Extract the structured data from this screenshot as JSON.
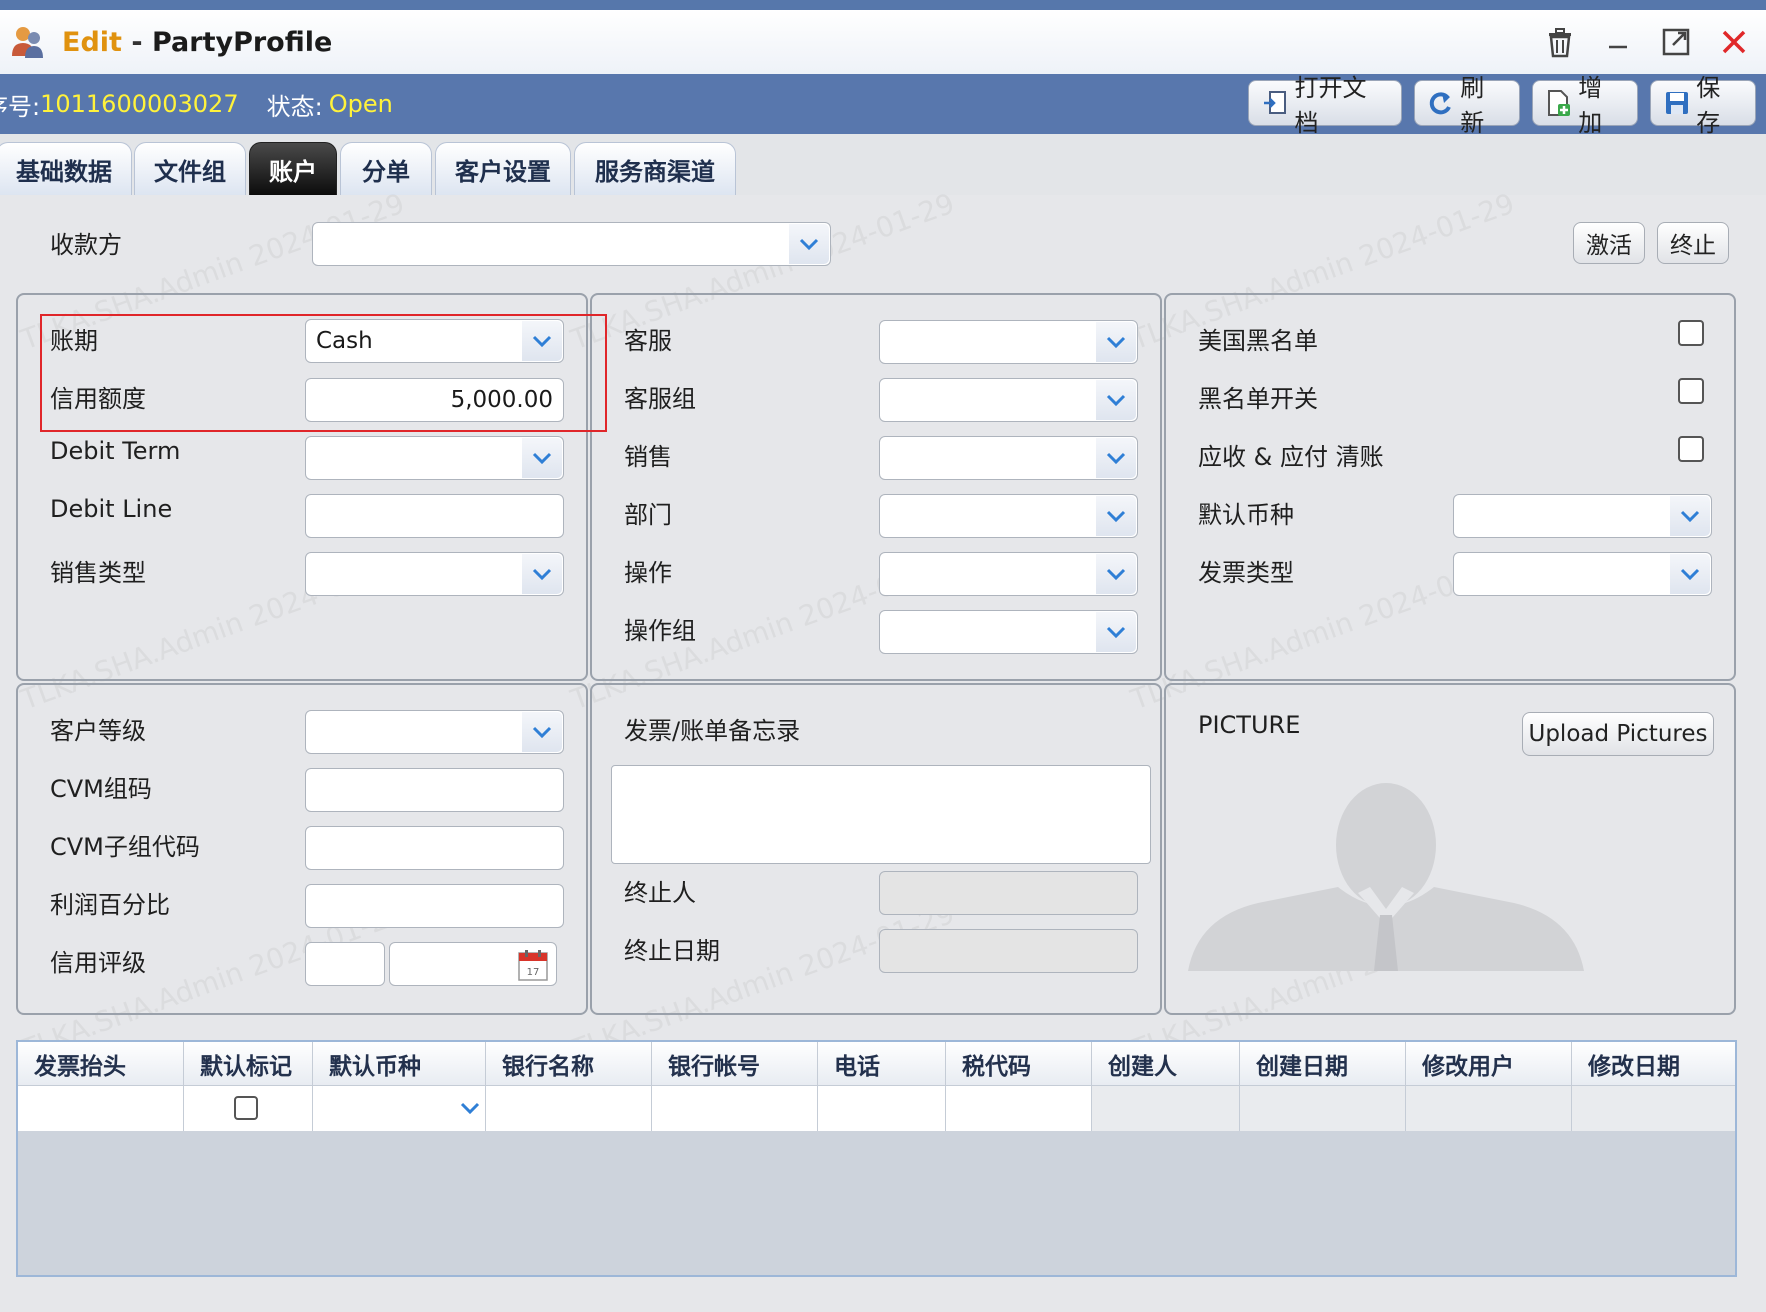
{
  "window": {
    "title_mode": "Edit",
    "title_sep": "-",
    "title_name": "PartyProfile"
  },
  "infobar": {
    "seq_label": "序号:",
    "seq_value": "1011600003027",
    "status_label": "状态:",
    "status_value": "Open"
  },
  "toolbar": {
    "open_doc": "打开文档",
    "refresh": "刷新",
    "add": "增加",
    "save": "保存"
  },
  "tabs": [
    "基础数据",
    "文件组",
    "账户",
    "分单",
    "客户设置",
    "服务商渠道"
  ],
  "active_tab": "账户",
  "payee": {
    "label": "收款方",
    "value": ""
  },
  "actions": {
    "activate": "激活",
    "terminate": "终止"
  },
  "panel1": {
    "payment_term_label": "账期",
    "payment_term_value": "Cash",
    "credit_limit_label": "信用额度",
    "credit_limit_value": "5,000.00",
    "debit_term_label": "Debit Term",
    "debit_line_label": "Debit Line",
    "sales_type_label": "销售类型"
  },
  "panel2": {
    "cs_label": "客服",
    "cs_group_label": "客服组",
    "sales_label": "销售",
    "dept_label": "部门",
    "op_label": "操作",
    "op_group_label": "操作组"
  },
  "panel3": {
    "us_blacklist_label": "美国黑名单",
    "blacklist_switch_label": "黑名单开关",
    "ar_ap_label": "应收 & 应付 清账",
    "default_currency_label": "默认币种",
    "invoice_type_label": "发票类型"
  },
  "panel4": {
    "cust_level_label": "客户等级",
    "cvm_group_label": "CVM组码",
    "cvm_subgroup_label": "CVM子组代码",
    "profit_pct_label": "利润百分比",
    "credit_rating_label": "信用评级"
  },
  "panel5": {
    "memo_label": "发票/账单备忘录",
    "terminated_by_label": "终止人",
    "terminated_date_label": "终止日期"
  },
  "panel6": {
    "picture_label": "PICTURE",
    "upload_button": "Upload Pictures"
  },
  "grid": {
    "columns": [
      "发票抬头",
      "默认标记",
      "默认币种",
      "银行名称",
      "银行帐号",
      "电话",
      "税代码",
      "创建人",
      "创建日期",
      "修改用户",
      "修改日期"
    ]
  },
  "watermark": "TLKA.SHA.Admin 2024-01-29",
  "colors": {
    "infobar_bg": "#5877ad",
    "seq_value": "#fff23b",
    "title_edit": "#e0920f",
    "highlight_box": "#e0262a",
    "dropdown_chevron": "#2f7fd6"
  }
}
